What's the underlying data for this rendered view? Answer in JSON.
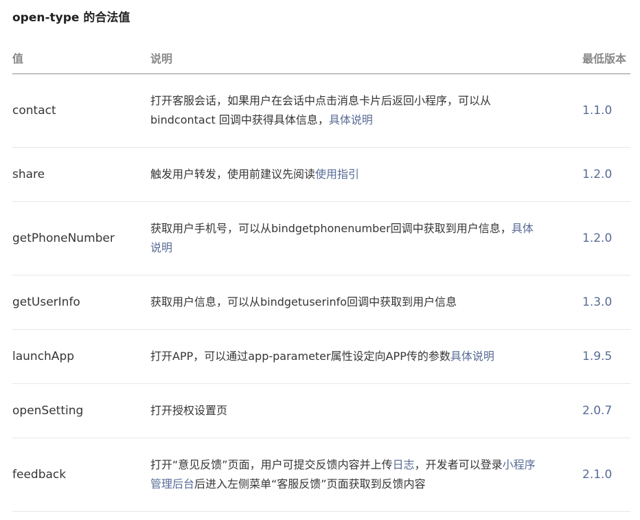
{
  "heading": "open-type 的合法值",
  "table": {
    "headers": [
      "值",
      "说明",
      "最低版本"
    ],
    "rows": [
      {
        "value": "contact",
        "desc": [
          {
            "text": "打开客服会话，如果用户在会话中点击消息卡片后返回小程序，可以从 bindcontact 回调中获得具体信息，"
          },
          {
            "text": "具体说明",
            "link": true
          }
        ],
        "version": "1.1.0"
      },
      {
        "value": "share",
        "desc": [
          {
            "text": "触发用户转发，使用前建议先阅读"
          },
          {
            "text": "使用指引",
            "link": true
          }
        ],
        "version": "1.2.0"
      },
      {
        "value": "getPhoneNumber",
        "desc": [
          {
            "text": "获取用户手机号，可以从bindgetphonenumber回调中获取到用户信息，"
          },
          {
            "text": "具体说明",
            "link": true
          }
        ],
        "version": "1.2.0"
      },
      {
        "value": "getUserInfo",
        "desc": [
          {
            "text": "获取用户信息，可以从bindgetuserinfo回调中获取到用户信息"
          }
        ],
        "version": "1.3.0"
      },
      {
        "value": "launchApp",
        "desc": [
          {
            "text": "打开APP，可以通过app-parameter属性设定向APP传的参数"
          },
          {
            "text": "具体说明",
            "link": true
          }
        ],
        "version": "1.9.5"
      },
      {
        "value": "openSetting",
        "desc": [
          {
            "text": "打开授权设置页"
          }
        ],
        "version": "2.0.7"
      },
      {
        "value": "feedback",
        "desc": [
          {
            "text": "打开“意见反馈”页面，用户可提交反馈内容并上传"
          },
          {
            "text": "日志",
            "link": true
          },
          {
            "text": "，开发者可以登录"
          },
          {
            "text": "小程序管理后台",
            "link": true
          },
          {
            "text": "后进入左侧菜单“客服反馈”页面获取到反馈内容"
          }
        ],
        "version": "2.1.0"
      }
    ]
  },
  "colors": {
    "link": "#576b95",
    "text": "#353535",
    "header": "#888888"
  }
}
